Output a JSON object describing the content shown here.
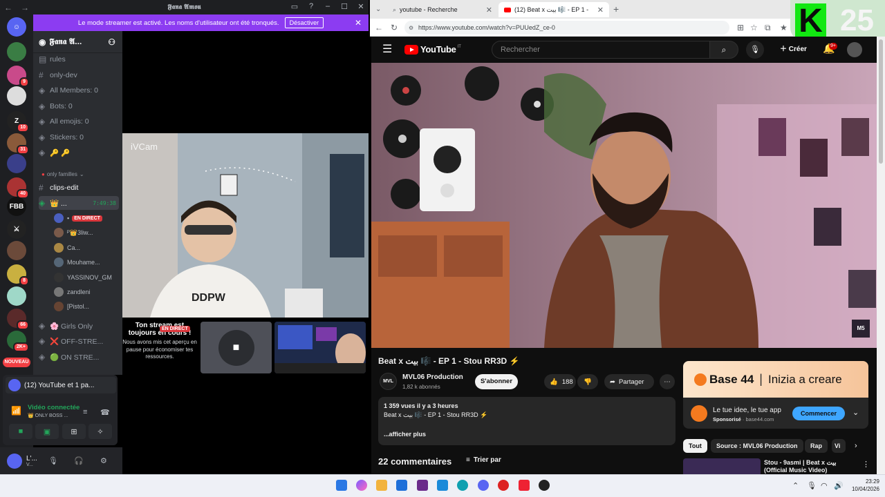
{
  "discord": {
    "titlebar": {
      "title": "𝕱𝖆𝖓𝖆 𝕬𝖒𝖔𝖚",
      "back": "←",
      "forward": "→"
    },
    "streamer_banner": {
      "text": "Le mode streamer est activé. Les noms d'utilisateur ont été tronqués.",
      "button": "Désactiver"
    },
    "server": {
      "name": "𝕱𝖆𝖓𝖆 𝕬..."
    },
    "rail": {
      "badges": [
        "9",
        "10",
        "31",
        "40",
        "8",
        "66",
        "2K+"
      ],
      "label_fbb": "FBB",
      "new_label": "NOUVEAU"
    },
    "channels": [
      {
        "name": "rules"
      },
      {
        "name": "only-dev"
      },
      {
        "name": "All Members: 0"
      },
      {
        "name": "Bots: 0"
      },
      {
        "name": "All emojis: 0"
      },
      {
        "name": "Stickers: 0"
      },
      {
        "name": "🔑 🔑"
      }
    ],
    "category": "only familles",
    "clips_channel": "clips-edit",
    "voice_channel": {
      "name": "👑 ...",
      "time": "7:49:38"
    },
    "voice_users": [
      {
        "name": "",
        "badge": "EN DIRECT"
      },
      {
        "name": "ᴾ👑3liw...",
        "badge": ""
      },
      {
        "name": "Ca...",
        "badge": ""
      },
      {
        "name": "Mouhame...",
        "badge": ""
      },
      {
        "name": "YASSINOV_GM",
        "badge": ""
      },
      {
        "name": "zandleni",
        "badge": ""
      },
      {
        "name": "[Pistol...",
        "badge": ""
      }
    ],
    "other_channels": [
      "🌸 Girls Only",
      "❌ OFF-STRE...",
      "🟢 ON STRE..."
    ],
    "camera_label": "iVCam",
    "paused": {
      "title": "Ton stream est toujours en cours !",
      "live": "EN DIRECT",
      "desc": "Nous avons mis cet aperçu en pause pour économiser tes ressources."
    },
    "notification": "(12) YouTube et 1 pa...",
    "voice_status": {
      "status": "Vidéo connectée",
      "sub": "👑 ONLY BOSS ..."
    },
    "user": {
      "name": "L'...",
      "sub": "V..."
    }
  },
  "browser": {
    "tabs": [
      {
        "label": "youtube - Recherche"
      },
      {
        "label": "(12) Beat x بيت 🎼 - EP 1 - Stou"
      }
    ],
    "url": "https://www.youtube.com/watch?v=PUUedZ_ce-0",
    "overlay_k": "K",
    "overlay_num": "25"
  },
  "youtube": {
    "logo": "YouTube",
    "logo_cc": "IT",
    "search_placeholder": "Rechercher",
    "create": "Créer",
    "bell_badge": "9+",
    "watermark": "M5",
    "title": "Beat x بيت 🎼 - EP 1 - Stou RR3D ⚡",
    "channel": {
      "name": "MVL06 Production",
      "subs": "1,82 k abonnés",
      "avatar": "MVL"
    },
    "subscribe": "S'abonner",
    "likes": "188",
    "share": "Partager",
    "description": {
      "stats": "1 359 vues  il y a 3 heures",
      "line": "Beat x بيت 🎼 - EP 1 - Stou RR3D ⚡",
      "more": "...afficher plus"
    },
    "comments": "22 commentaires",
    "sort": "Trier par",
    "ad": {
      "brand": "Base 44",
      "tagline": "Inizia a creare",
      "title": "Le tue idee, le tue app",
      "sponsored": "Sponsorisé",
      "domain": "base44.com",
      "cta": "Commencer"
    },
    "chips": [
      "Tout",
      "Source : MVL06 Production",
      "Rap",
      "Vi"
    ],
    "rec_title": "Stou - 9asmi | Beat x بيت (Official Music Video)"
  },
  "taskbar": {
    "time": "23:29",
    "date": "10/04/2026"
  }
}
